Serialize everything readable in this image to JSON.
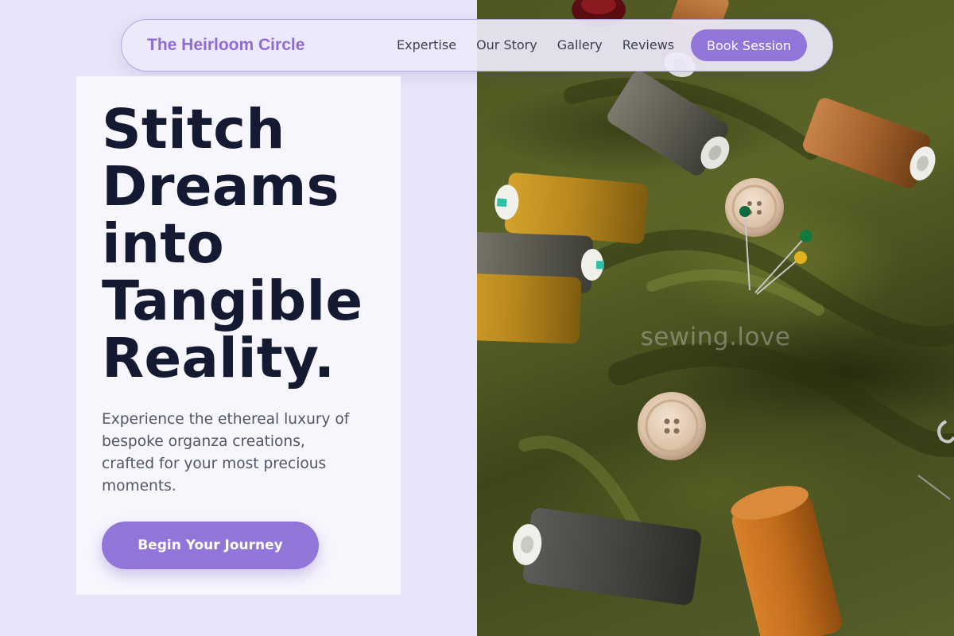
{
  "nav": {
    "brand": "The Heirloom Circle",
    "links": [
      "Expertise",
      "Our Story",
      "Gallery",
      "Reviews"
    ],
    "cta_label": "Book Session"
  },
  "hero": {
    "headline_lines": [
      "Stitch",
      "Dreams",
      "into",
      "Tangible",
      "Reality."
    ],
    "subtext_lines": [
      "Experience the ethereal luxury of",
      "bespoke organza creations,",
      "crafted for your most precious",
      "moments."
    ],
    "cta_label": "Begin Your Journey"
  },
  "photo": {
    "subject": "thread-spools-buttons-pins-on-olive-fabric",
    "watermark": "sewing.love"
  },
  "colors": {
    "accent": "#9275d9",
    "brand_text": "#8f6bd6",
    "headline": "#131a31",
    "page_background": "#e7e4f9",
    "fabric": "#535c24"
  }
}
